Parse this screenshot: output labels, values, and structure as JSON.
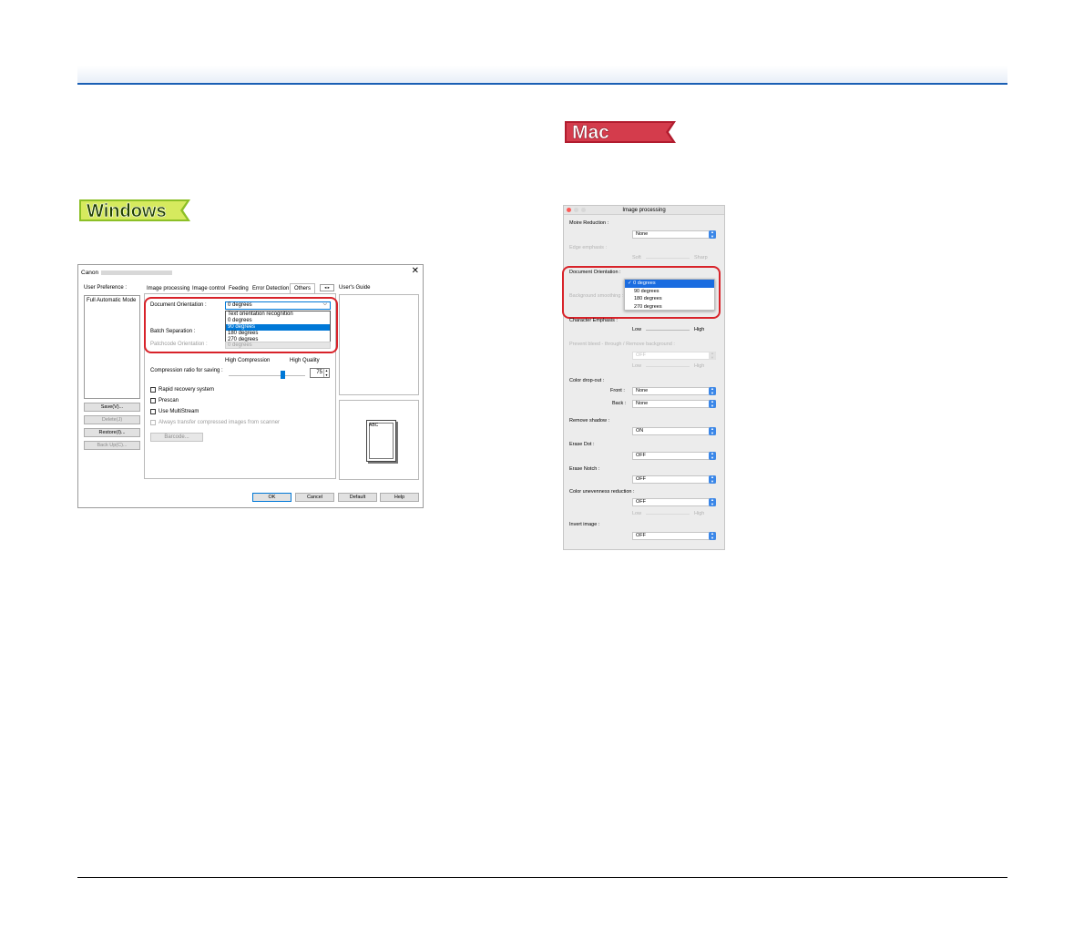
{
  "badges": {
    "windows": "Windows",
    "mac": "Mac"
  },
  "win": {
    "title": "Canon",
    "user_preference_label": "User Preference :",
    "preference_items": [
      "Full Automatic Mode"
    ],
    "buttons": {
      "save": "Save(V)...",
      "delete": "Delete(J)",
      "restore": "Restore(I)...",
      "backup": "Back Up(C)..."
    },
    "tabs": [
      "Image processing",
      "Image control",
      "Feeding",
      "Error Detection",
      "Others"
    ],
    "tab_arrows": "◂ ▸",
    "users_guide_label": "User's Guide",
    "document_orientation_label": "Document Orientation :",
    "document_orientation_value": "0 degrees",
    "orientation_options": [
      "Text orientation recognition",
      "0 degrees",
      "90 degrees",
      "180 degrees",
      "270 degrees"
    ],
    "batch_separation_label": "Batch Separation :",
    "patchcode_orientation_label": "Patchcode Orientation :",
    "patchcode_orientation_value": "0 degrees",
    "high_compression_label": "High Compression",
    "high_quality_label": "High Quality",
    "compression_label": "Compression ratio for saving :",
    "compression_value": "75",
    "rapid_recovery_label": "Rapid recovery system",
    "prescan_label": "Prescan",
    "multistream_label": "Use MultiStream",
    "always_transfer_label": "Always transfer compressed images from scanner",
    "barcode_label": "Barcode...",
    "preview_text": "ABC",
    "ok_label": "OK",
    "cancel_label": "Cancel",
    "default_label": "Default",
    "help_label": "Help"
  },
  "mac": {
    "title": "Image processing",
    "moire_label": "Moire Reduction :",
    "moire_value": "None",
    "edge_label": "Edge emphasis :",
    "soft_label": "Soft",
    "sharp_label": "Sharp",
    "doc_orientation_label": "Document Orientation :",
    "orientation_options": [
      "0 degrees",
      "90 degrees",
      "180 degrees",
      "270 degrees"
    ],
    "checkmark": "✓",
    "background_label": "Background smoothing :",
    "char_emphasis_label": "Character Emphasis :",
    "low_label": "Low",
    "high_label": "High",
    "bleed_label": "Prevent bleed - through / Remove background :",
    "bleed_value": "OFF",
    "color_dropout_label": "Color drop-out :",
    "front_label": "Front :",
    "front_value": "None",
    "back_label": "Back :",
    "back_value": "None",
    "remove_shadow_label": "Remove shadow :",
    "remove_shadow_value": "ON",
    "erase_dot_label": "Erase Dot :",
    "erase_dot_value": "OFF",
    "erase_notch_label": "Erase Notch :",
    "erase_notch_value": "OFF",
    "unevenness_label": "Color unevenness reduction :",
    "unevenness_value": "OFF",
    "invert_label": "Invert image :",
    "invert_value": "OFF"
  },
  "colors": {
    "accent_blue": "#1a5fb4",
    "highlight_red": "#d8232a",
    "win_select": "#0078d7",
    "mac_select": "#1a6ce0",
    "mac_popup": "#3b87e8"
  },
  "icons": {
    "close": "close-icon",
    "popup_arrows": "popup-arrow-icon",
    "spin_arrows": "spin-arrow-icon",
    "dropdown": "chevron-down-icon"
  }
}
